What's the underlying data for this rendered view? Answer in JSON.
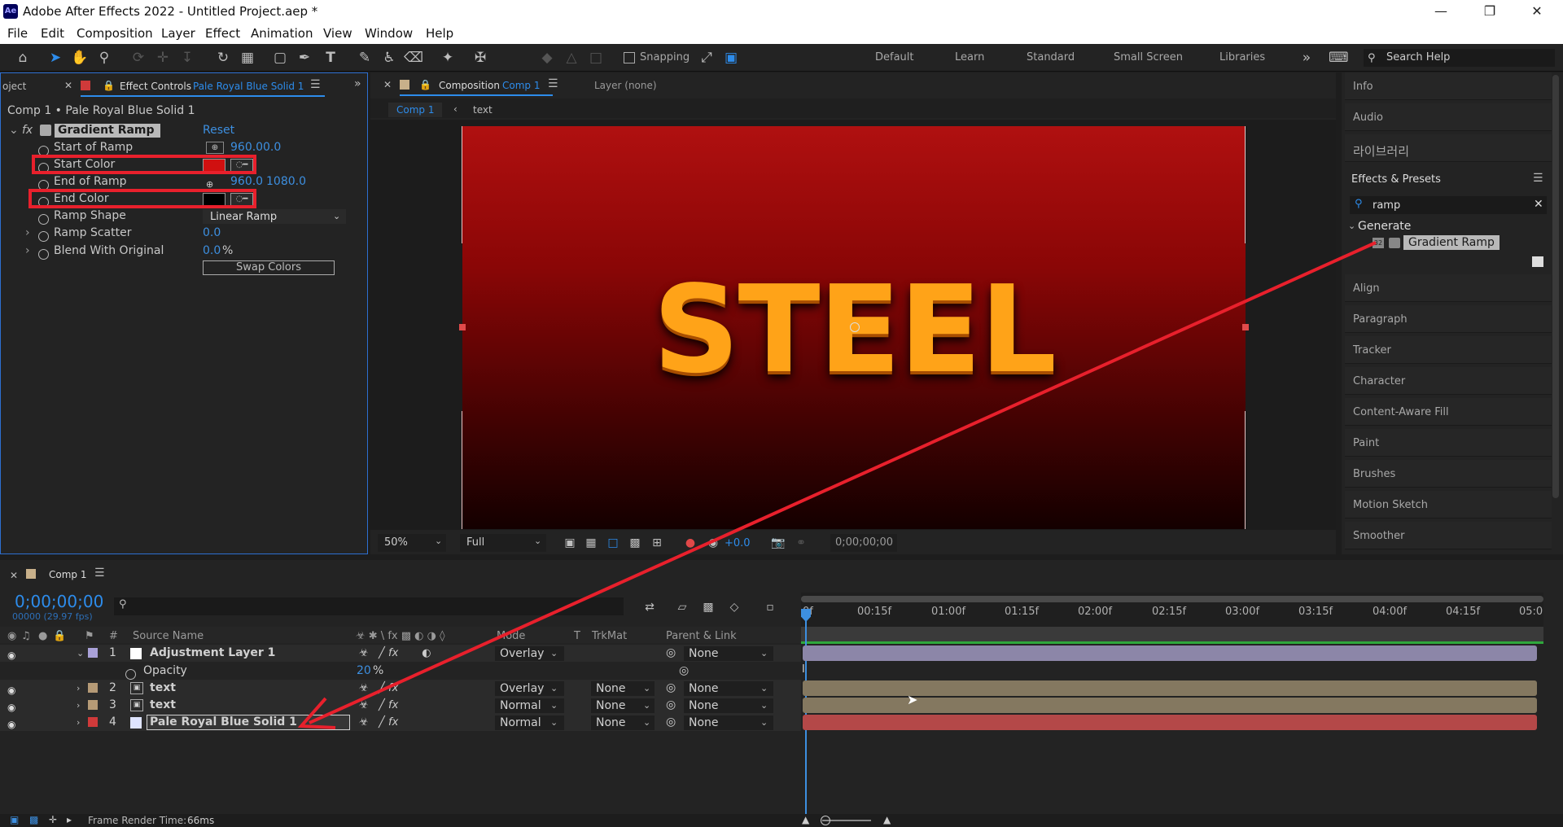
{
  "window": {
    "title": "Adobe After Effects 2022 - Untitled Project.aep *",
    "app_icon": "Ae",
    "controls": [
      "minimize",
      "restore",
      "close"
    ]
  },
  "menu": [
    "File",
    "Edit",
    "Composition",
    "Layer",
    "Effect",
    "Animation",
    "View",
    "Window",
    "Help"
  ],
  "toolbar": {
    "snapping_label": "Snapping",
    "workspaces": [
      "Default",
      "Learn",
      "Standard",
      "Small Screen",
      "Libraries"
    ],
    "search_placeholder": "Search Help"
  },
  "effect_controls": {
    "project_tab": "oject",
    "tab_label": "Effect Controls",
    "tab_layer": "Pale Royal Blue Solid 1",
    "breadcrumb": "Comp 1 • Pale Royal Blue Solid 1",
    "effect_name": "Gradient Ramp",
    "reset_label": "Reset",
    "properties": {
      "start_of_ramp": {
        "label": "Start of Ramp",
        "x": "960.0",
        "y": "0.0"
      },
      "start_color": {
        "label": "Start Color",
        "color": "#d01010"
      },
      "end_of_ramp": {
        "label": "End of Ramp",
        "x": "960.0",
        "y": "1080.0"
      },
      "end_color": {
        "label": "End Color",
        "color": "#000000"
      },
      "ramp_shape": {
        "label": "Ramp Shape",
        "value": "Linear Ramp"
      },
      "ramp_scatter": {
        "label": "Ramp Scatter",
        "value": "0.0"
      },
      "blend": {
        "label": "Blend With Original",
        "value": "0.0",
        "unit": "%"
      }
    },
    "swap_button": "Swap Colors"
  },
  "composition": {
    "tab_label": "Composition",
    "tab_comp": "Comp 1",
    "layer_label": "Layer (none)",
    "breadcrumbs": [
      "Comp 1",
      "text"
    ],
    "canvas_text": "STEEL",
    "zoom": "50%",
    "resolution": "Full",
    "exposure": "+0.0",
    "timecode": "0;00;00;00"
  },
  "right_panels": {
    "info": "Info",
    "audio": "Audio",
    "library": "라이브러리",
    "effects_presets": "Effects & Presets",
    "search_value": "ramp",
    "category": "Generate",
    "result": "Gradient Ramp",
    "panels": [
      "Align",
      "Paragraph",
      "Tracker",
      "Character",
      "Content-Aware Fill",
      "Paint",
      "Brushes",
      "Motion Sketch",
      "Smoother"
    ]
  },
  "timeline": {
    "tab_label": "Comp 1",
    "timecode": "0;00;00;00",
    "frame_info": "00000 (29.97 fps)",
    "columns": {
      "num": "#",
      "source": "Source Name",
      "mode": "Mode",
      "t": "T",
      "trkmat": "TrkMat",
      "parent": "Parent & Link"
    },
    "ruler": [
      "0f",
      "00:15f",
      "01:00f",
      "01:15f",
      "02:00f",
      "02:15f",
      "03:00f",
      "03:15f",
      "04:00f",
      "04:15f",
      "05:0"
    ],
    "layers": [
      {
        "num": "1",
        "name": "Adjustment Layer 1",
        "mode": "Overlay",
        "trkmat": "",
        "parent": "None",
        "label_color": "#a9a1d8"
      },
      {
        "num": "2",
        "name": "text",
        "mode": "Overlay",
        "trkmat": "None",
        "parent": "None",
        "label_color": "#b59a76"
      },
      {
        "num": "3",
        "name": "text",
        "mode": "Normal",
        "trkmat": "None",
        "parent": "None",
        "label_color": "#b59a76"
      },
      {
        "num": "4",
        "name": "Pale Royal Blue Solid 1",
        "mode": "Normal",
        "trkmat": "None",
        "parent": "None",
        "label_color": "#d03a3a"
      }
    ],
    "opacity": {
      "label": "Opacity",
      "value": "20",
      "unit": "%"
    },
    "status_label": "Frame Render Time:",
    "status_value": "66ms"
  },
  "colors": {
    "accent": "#2d8ceb",
    "annotation_red": "#e8202c"
  }
}
